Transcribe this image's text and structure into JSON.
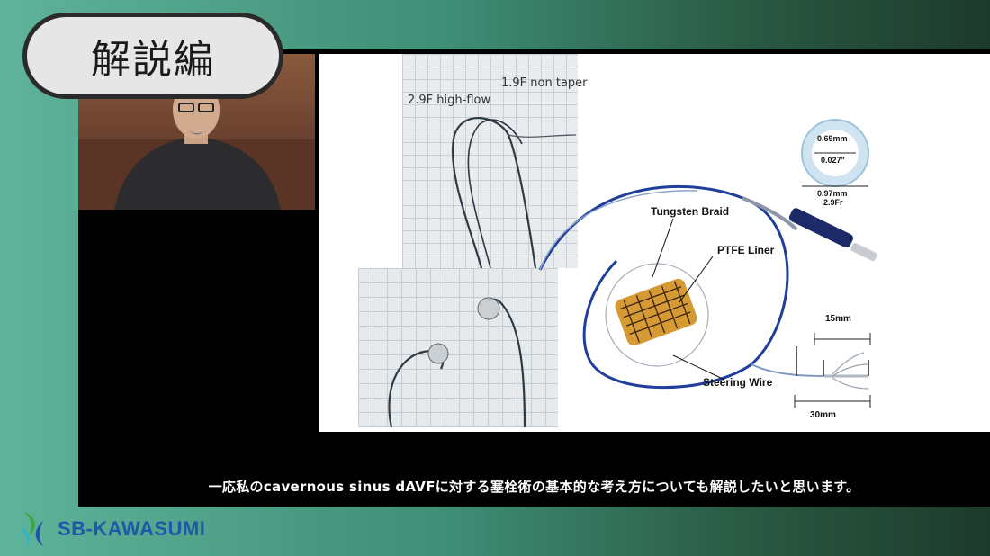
{
  "header": {
    "title": "解説編"
  },
  "slide": {
    "label_nontaper": "1.9F non taper",
    "label_highflow": "2.9F high-flow",
    "tungsten_braid": "Tungsten Braid",
    "ptfe_liner": "PTFE Liner",
    "steering_wire": "Steering Wire",
    "dim_15": "15mm",
    "dim_30": "30mm",
    "ring_inner_mm": "0.69mm",
    "ring_inner_in": "0.027\"",
    "ring_outer_mm": "0.97mm",
    "ring_outer_fr": "2.9Fr"
  },
  "caption": {
    "text": "一応私のcavernous sinus dAVFに対する塞栓術の基本的な考え方についても解説したいと思います。"
  },
  "brand": {
    "name": "SB-KAWASUMI"
  },
  "colors": {
    "brand_blue": "#1c5aa8",
    "brand_green": "#3aa64a",
    "catheter_blue": "#1f3f9a"
  }
}
